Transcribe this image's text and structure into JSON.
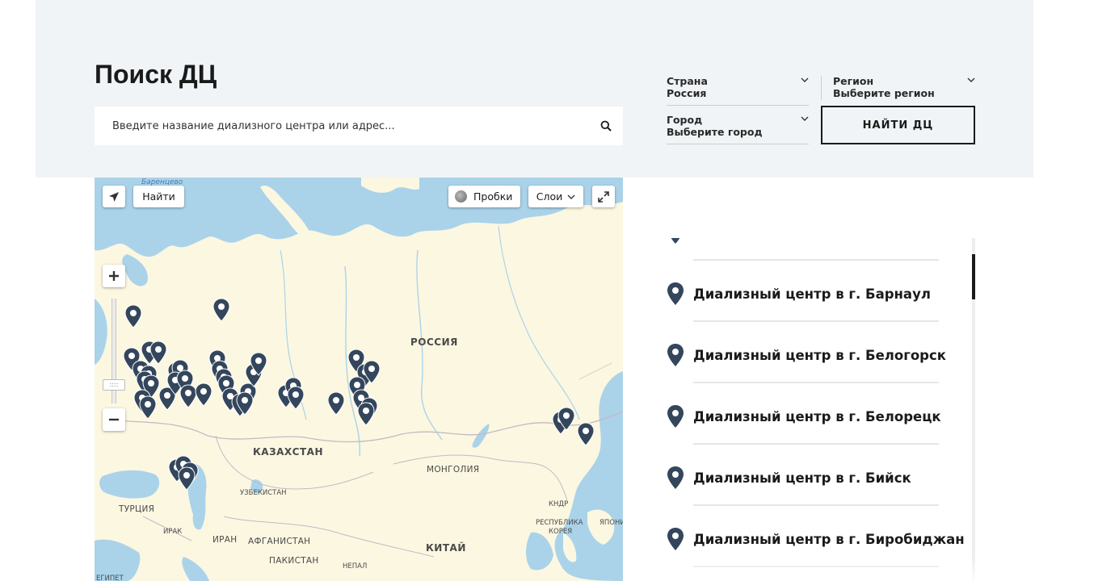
{
  "page": {
    "title": "Поиск ДЦ"
  },
  "search": {
    "placeholder": "Введите название диализного центра или адрес..."
  },
  "filters": {
    "country": {
      "label": "Страна",
      "value": "Россия"
    },
    "region": {
      "label": "Регион",
      "value": "Выберите регион"
    },
    "city": {
      "label": "Город",
      "value": "Выберите город"
    },
    "find_button": "НАЙТИ ДЦ"
  },
  "map": {
    "controls": {
      "find": "Найти",
      "traffic": "Пробки",
      "layers": "Слои"
    },
    "labels": {
      "barents": "Баренцево",
      "russia": "РОССИЯ",
      "kazakhstan": "КАЗАХСТАН",
      "mongolia": "МОНГОЛИЯ",
      "uzbekistan": "УЗБЕКИСТАН",
      "turkey": "ТУРЦИЯ",
      "iraq": "ИРАК",
      "iran": "ИРАН",
      "afghanistan": "АФГАНИСТАН",
      "pakistan": "ПАКИСТАН",
      "nepal": "НЕПАЛ",
      "china": "КИТАЙ",
      "dprk": "КНДР",
      "korea_1": "РЕСПУБЛИКА",
      "korea_2": "КОРЕЯ",
      "japan": "ЯПОНИ",
      "egypt": "ЕГИПЕТ"
    },
    "marker_color": "#34465c"
  },
  "centers": [
    {
      "name": "Диализный центр в г. Барнаул"
    },
    {
      "name": "Диализный центр в г. Белогорск"
    },
    {
      "name": "Диализный центр в г. Белорецк"
    },
    {
      "name": "Диализный центр в г. Бийск"
    },
    {
      "name": "Диализный центр в г. Биробиджан"
    }
  ],
  "colors": {
    "panel_bg": "#f0f4f7",
    "land": "#fcf7e1",
    "water": "#aad3ea",
    "accent": "#1a1a1a"
  }
}
